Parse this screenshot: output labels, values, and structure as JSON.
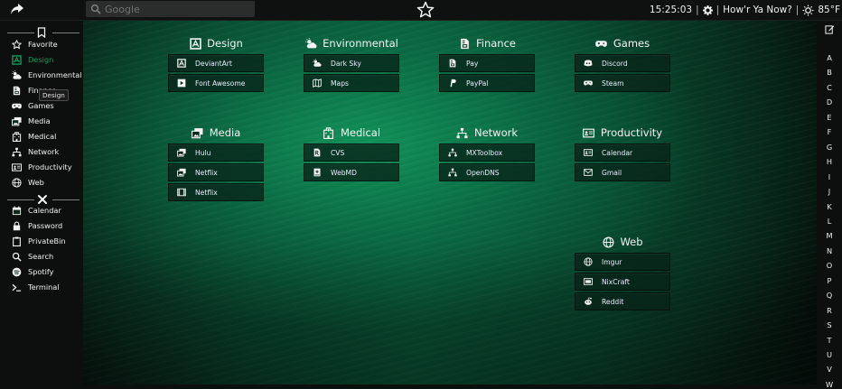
{
  "search": {
    "placeholder": "Google"
  },
  "status": {
    "time": "15:25:03",
    "greeting": "How'r Ya Now?",
    "temperature": "85°F"
  },
  "sidebar": {
    "categories": [
      {
        "label": "Favorite",
        "icon": "star-icon"
      },
      {
        "label": "Design",
        "icon": "design-icon",
        "active": true
      },
      {
        "label": "Environmental",
        "icon": "cloud-sun-icon"
      },
      {
        "label": "Finance",
        "icon": "file-invoice-icon"
      },
      {
        "label": "Games",
        "icon": "gamepad-icon"
      },
      {
        "label": "Media",
        "icon": "photo-video-icon"
      },
      {
        "label": "Medical",
        "icon": "hospital-icon"
      },
      {
        "label": "Network",
        "icon": "network-icon"
      },
      {
        "label": "Productivity",
        "icon": "id-card-icon"
      },
      {
        "label": "Web",
        "icon": "globe-icon"
      }
    ],
    "tools": [
      {
        "label": "Calendar",
        "icon": "calendar-icon"
      },
      {
        "label": "Password",
        "icon": "lock-icon"
      },
      {
        "label": "PrivateBin",
        "icon": "clipboard-icon"
      },
      {
        "label": "Search",
        "icon": "search-icon"
      },
      {
        "label": "Spotify",
        "icon": "spotify-icon"
      },
      {
        "label": "Terminal",
        "icon": "terminal-icon"
      }
    ],
    "tooltip": "Design"
  },
  "categories": [
    {
      "title": "Design",
      "icon": "design-icon",
      "links": [
        {
          "label": "DeviantArt",
          "icon": "design-icon"
        },
        {
          "label": "Font Awesome",
          "icon": "play-icon"
        }
      ]
    },
    {
      "title": "Environmental",
      "icon": "cloud-sun-icon",
      "links": [
        {
          "label": "Dark Sky",
          "icon": "cloud-sun-icon"
        },
        {
          "label": "Maps",
          "icon": "map-icon"
        }
      ]
    },
    {
      "title": "Finance",
      "icon": "file-invoice-icon",
      "links": [
        {
          "label": "Pay",
          "icon": "file-invoice-icon"
        },
        {
          "label": "PayPal",
          "icon": "paypal-icon"
        }
      ]
    },
    {
      "title": "Games",
      "icon": "gamepad-icon",
      "links": [
        {
          "label": "Discord",
          "icon": "discord-icon"
        },
        {
          "label": "Steam",
          "icon": "gamepad-icon"
        }
      ]
    },
    {
      "title": "Media",
      "icon": "photo-video-icon",
      "links": [
        {
          "label": "Hulu",
          "icon": "photo-video-icon"
        },
        {
          "label": "Netflix",
          "icon": "photo-video-icon"
        },
        {
          "label": "Netflix",
          "icon": "film-icon"
        }
      ]
    },
    {
      "title": "Medical",
      "icon": "hospital-icon",
      "links": [
        {
          "label": "CVS",
          "icon": "prescription-icon"
        },
        {
          "label": "WebMD",
          "icon": "medical-book-icon"
        }
      ]
    },
    {
      "title": "Network",
      "icon": "network-icon",
      "links": [
        {
          "label": "MXToolbox",
          "icon": "network-icon"
        },
        {
          "label": "OpenDNS",
          "icon": "network-icon"
        }
      ]
    },
    {
      "title": "Productivity",
      "icon": "id-card-icon",
      "links": [
        {
          "label": "Calendar",
          "icon": "id-card-icon"
        },
        {
          "label": "Gmail",
          "icon": "envelope-icon"
        }
      ]
    },
    {
      "title": "Web",
      "icon": "globe-icon",
      "links": [
        {
          "label": "Imgur",
          "icon": "globe-icon"
        },
        {
          "label": "NixCraft",
          "icon": "id-badge-icon"
        },
        {
          "label": "Reddit",
          "icon": "reddit-icon"
        }
      ]
    }
  ],
  "alphabet": [
    "A",
    "B",
    "C",
    "D",
    "E",
    "F",
    "G",
    "H",
    "I",
    "J",
    "K",
    "L",
    "M",
    "N",
    "O",
    "P",
    "Q",
    "R",
    "S",
    "T",
    "U",
    "V",
    "W"
  ],
  "colors": {
    "active": "#0f9c5f",
    "background": "#0d6b45"
  }
}
